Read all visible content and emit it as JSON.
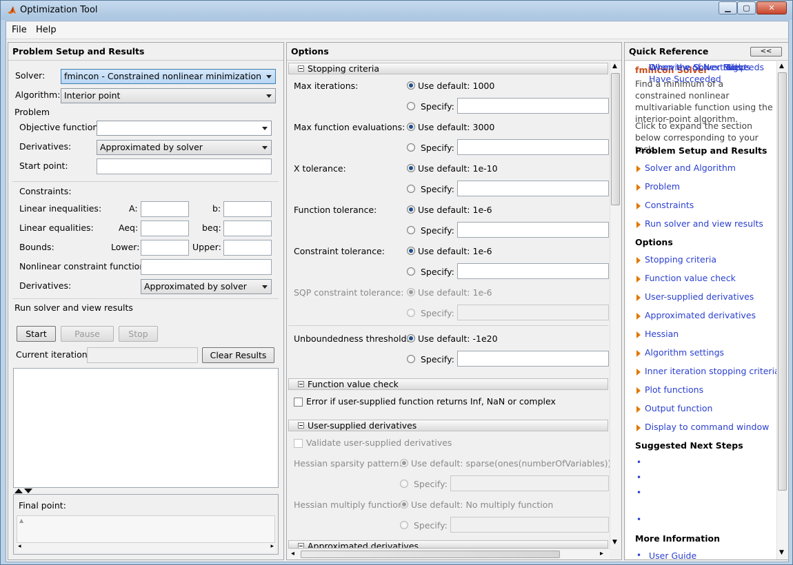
{
  "window": {
    "title": "Optimization Tool"
  },
  "menubar": {
    "file": "File",
    "help": "Help"
  },
  "left": {
    "header": "Problem Setup and Results",
    "solver_label": "Solver:",
    "solver_value": "fmincon - Constrained nonlinear minimization",
    "algorithm_label": "Algorithm:",
    "algorithm_value": "Interior point",
    "problem_label": "Problem",
    "objective_label": "Objective function:",
    "objective_value": "",
    "derivatives_label": "Derivatives:",
    "derivatives_value": "Approximated by solver",
    "start_point_label": "Start point:",
    "constraints_label": "Constraints:",
    "lin_ineq_label": "Linear inequalities:",
    "a_label": "A:",
    "b_label": "b:",
    "lin_eq_label": "Linear equalities:",
    "aeq_label": "Aeq:",
    "beq_label": "beq:",
    "bounds_label": "Bounds:",
    "lower_label": "Lower:",
    "upper_label": "Upper:",
    "nonlin_label": "Nonlinear constraint function:",
    "nonlin_deriv_label": "Derivatives:",
    "nonlin_deriv_value": "Approximated by solver",
    "run_label": "Run solver and view results",
    "start_btn": "Start",
    "pause_btn": "Pause",
    "stop_btn": "Stop",
    "current_iter_label": "Current iteration:",
    "clear_btn": "Clear Results",
    "final_point_label": "Final point:"
  },
  "options": {
    "header": "Options",
    "stopping_section": "Stopping criteria",
    "use_default_prefix": "Use default:",
    "specify_label": "Specify:",
    "rows": [
      {
        "label": "Max iterations:",
        "default": "1000",
        "disabled": false
      },
      {
        "label": "Max function evaluations:",
        "default": "3000",
        "disabled": false
      },
      {
        "label": "X tolerance:",
        "default": "1e-10",
        "disabled": false
      },
      {
        "label": "Function tolerance:",
        "default": "1e-6",
        "disabled": false
      },
      {
        "label": "Constraint tolerance:",
        "default": "1e-6",
        "disabled": false
      },
      {
        "label": "SQP constraint tolerance:",
        "default": "1e-6",
        "disabled": true
      },
      {
        "label": "Unboundedness threshold:",
        "default": "-1e20",
        "disabled": false
      }
    ],
    "fvc_section": "Function value check",
    "fvc_check": "Error if user-supplied function returns Inf, NaN or complex",
    "usd_section": "User-supplied derivatives",
    "usd_check": "Validate user-supplied derivatives",
    "hess_sparsity_label": "Hessian sparsity pattern:",
    "hess_sparsity_default": "sparse(ones(numberOfVariables))",
    "hess_mult_label": "Hessian multiply function:",
    "hess_mult_default": "No multiply function",
    "approx_section": "Approximated derivatives"
  },
  "quickref": {
    "header": "Quick Reference",
    "collapse": "<<",
    "solver_title": "fmincon Solver",
    "desc1": "Find a minimum of a constrained nonlinear multivariable function using the interior-point algorithm.",
    "desc2": "Click to expand the section below corresponding to your task.",
    "psr_head": "Problem Setup and Results",
    "psr_links": [
      "Solver and Algorithm",
      "Problem",
      "Constraints",
      "Run solver and view results"
    ],
    "opt_head": "Options",
    "opt_links": [
      "Stopping criteria",
      "Function value check",
      "User-supplied derivatives",
      "Approximated derivatives",
      "Hessian",
      "Algorithm settings",
      "Inner iteration stopping criteria",
      "Plot functions",
      "Output function",
      "Display to command window"
    ],
    "next_head": "Suggested Next Steps",
    "next_links": [
      "Overview of Next Steps",
      "When the Solver Fails",
      "When the Solver Might Have Succeeded",
      "When the Solver Succeeds"
    ],
    "more_head": "More Information",
    "more_links": [
      "User Guide"
    ]
  }
}
